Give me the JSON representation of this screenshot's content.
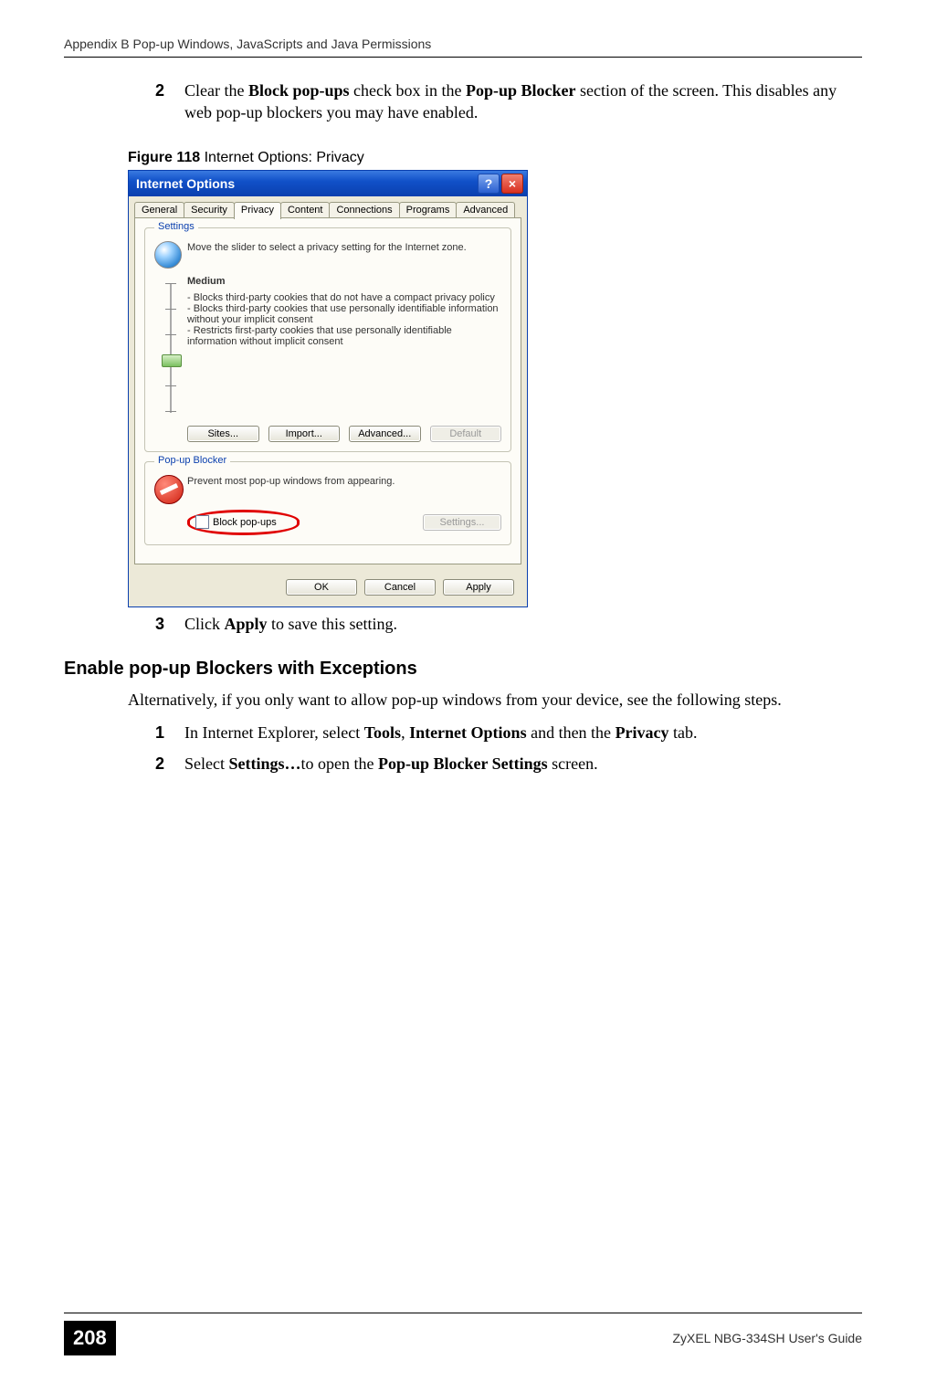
{
  "header": {
    "running": "Appendix B Pop-up Windows, JavaScripts and Java Permissions"
  },
  "steps_top": {
    "s2_num": "2",
    "s2_prefix": "Clear the ",
    "s2_b1": "Block pop-ups",
    "s2_mid1": " check box in the ",
    "s2_b2": "Pop-up Blocker",
    "s2_mid2": " section of the screen. This disables any web pop-up blockers you may have enabled."
  },
  "figure": {
    "label_bold": "Figure 118",
    "label_rest": "   Internet Options: Privacy"
  },
  "dialog": {
    "title": "Internet Options",
    "help_glyph": "?",
    "close_glyph": "×",
    "tabs": {
      "general": "General",
      "security": "Security",
      "privacy": "Privacy",
      "content": "Content",
      "connections": "Connections",
      "programs": "Programs",
      "advanced": "Advanced"
    },
    "settings_group": {
      "legend": "Settings",
      "intro": "Move the slider to select a privacy setting for the Internet zone.",
      "level": "Medium",
      "b1": "- Blocks third-party cookies that do not have a compact privacy policy",
      "b2": "- Blocks third-party cookies that use personally identifiable information without your implicit consent",
      "b3": "- Restricts first-party cookies that use personally identifiable information without implicit consent",
      "btn_sites": "Sites...",
      "btn_import": "Import...",
      "btn_advanced": "Advanced...",
      "btn_default": "Default"
    },
    "popup_group": {
      "legend": "Pop-up Blocker",
      "intro": "Prevent most pop-up windows from appearing.",
      "chk_label": "Block pop-ups",
      "btn_settings": "Settings..."
    },
    "footer": {
      "ok": "OK",
      "cancel": "Cancel",
      "apply": "Apply"
    }
  },
  "steps_mid": {
    "s3_num": "3",
    "s3_prefix": "Click ",
    "s3_b1": "Apply",
    "s3_rest": " to save this setting."
  },
  "section": {
    "heading": "Enable pop-up Blockers with Exceptions",
    "intro": "Alternatively, if you only want to allow pop-up windows from your device, see the following steps.",
    "s1_num": "1",
    "s1_pre": "In Internet Explorer, select ",
    "s1_b1": "Tools",
    "s1_mid1": ", ",
    "s1_b2": "Internet Options",
    "s1_mid2": " and then the ",
    "s1_b3": "Privacy",
    "s1_post": " tab.",
    "s2_num": "2",
    "s2_pre": "Select ",
    "s2_b1": "Settings…",
    "s2_mid": "to open the ",
    "s2_b2": "Pop-up Blocker Settings",
    "s2_post": " screen."
  },
  "footer": {
    "page": "208",
    "guide": "ZyXEL NBG-334SH User's Guide"
  }
}
